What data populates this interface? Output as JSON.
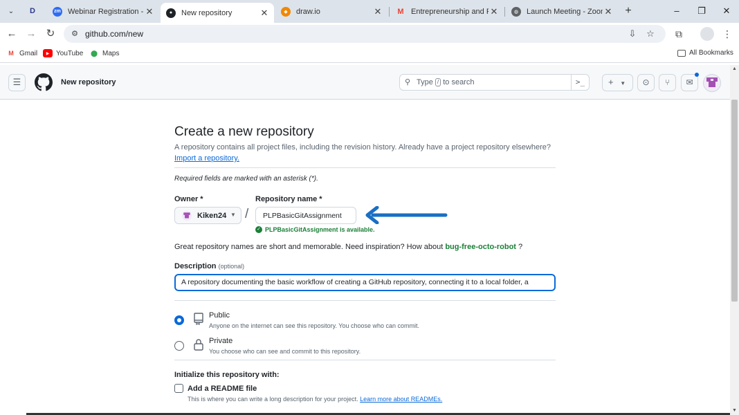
{
  "browser": {
    "tabs": [
      {
        "title": "Webinar Registration - Zoom",
        "icon": "zoom-icon",
        "color": "#2d6cf3"
      },
      {
        "title": "New repository",
        "icon": "github-icon",
        "color": "#1f2328",
        "active": true
      },
      {
        "title": "draw.io",
        "icon": "drawio-icon",
        "color": "#f08705"
      },
      {
        "title": "Entrepreneurship and Personal",
        "icon": "gmail-icon",
        "color": "#ea4335"
      },
      {
        "title": "Launch Meeting - Zoom",
        "icon": "globe-icon",
        "color": "#5f6368"
      }
    ],
    "pinned_tab_label": "D",
    "url": "github.com/new",
    "bookmarks": [
      {
        "label": "Gmail",
        "icon": "gmail-icon"
      },
      {
        "label": "YouTube",
        "icon": "youtube-icon"
      },
      {
        "label": "Maps",
        "icon": "maps-icon"
      }
    ],
    "all_bookmarks": "All Bookmarks"
  },
  "github": {
    "header_title": "New repository",
    "search": {
      "prefix": "Type",
      "key": "/",
      "suffix": "to search"
    },
    "accent": "#0969da",
    "success": "#1a7f37"
  },
  "form": {
    "title": "Create a new repository",
    "lead": "A repository contains all project files, including the revision history. Already have a project repository elsewhere?",
    "import_link": "Import a repository.",
    "required_note": "Required fields are marked with an asterisk (*).",
    "owner_label": "Owner *",
    "owner_value": "Kiken24",
    "slash": "/",
    "repo_label": "Repository name *",
    "repo_value": "PLPBasicGitAssignment",
    "availability": "PLPBasicGitAssignment is available.",
    "inspiration_text": "Great repository names are short and memorable. Need inspiration? How about",
    "inspiration_suggestion": "bug-free-octo-robot",
    "inspiration_end": "?",
    "description_label": "Description",
    "description_optional": "(optional)",
    "description_value": "A repository documenting the basic workflow of creating a GitHub repository, connecting it to a local folder, a",
    "visibility": [
      {
        "title": "Public",
        "subtitle": "Anyone on the internet can see this repository. You choose who can commit.",
        "selected": true,
        "icon": "repo-icon"
      },
      {
        "title": "Private",
        "subtitle": "You choose who can see and commit to this repository.",
        "selected": false,
        "icon": "lock-icon"
      }
    ],
    "init_title": "Initialize this repository with:",
    "readme_label": "Add a README file",
    "readme_sub": "This is where you can write a long description for your project.",
    "readme_link": "Learn more about READMEs."
  }
}
